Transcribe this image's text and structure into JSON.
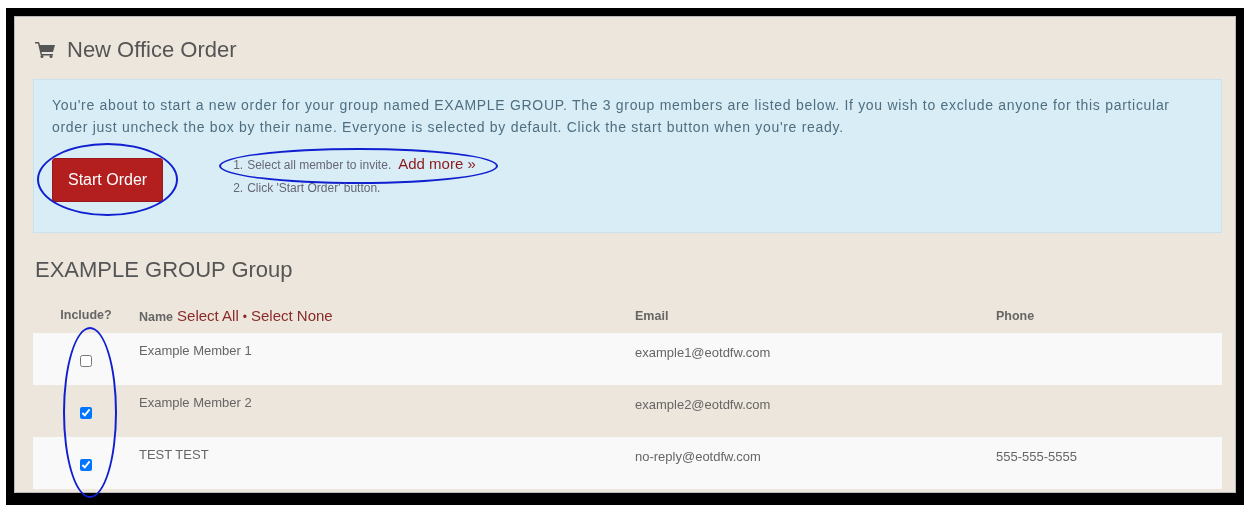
{
  "title": "New Office Order",
  "alert": {
    "text": "You're about to start a new order for your group named EXAMPLE GROUP. The 3 group members are listed below. If you wish to exclude anyone for this particular order just uncheck the box by their name. Everyone is selected by default. Click the start button when you're ready.",
    "button": {
      "label": "Start Order",
      "circled": true
    },
    "steps": [
      {
        "number": "1.",
        "text": "Select all member to invite.",
        "link": "Add more »",
        "circled": true
      },
      {
        "number": "2.",
        "text": "Click 'Start Order' button.",
        "circled": false
      }
    ]
  },
  "group_title": "EXAMPLE GROUP Group",
  "table": {
    "include_header": "Include?",
    "include_circled": true,
    "name_header": "Name",
    "select_all": "Select All",
    "separator": "•",
    "select_none": "Select None",
    "email_header": "Email",
    "phone_header": "Phone",
    "rows": [
      {
        "included": false,
        "name": "Example Member 1",
        "email": "example1@eotdfw.com"
      },
      {
        "included": true,
        "name": "Example Member 2",
        "email": "example2@eotdfw.com"
      },
      {
        "included": true,
        "name": "TEST TEST",
        "email": "no-reply@eotdfw.com",
        "phone": "555-555-5555"
      }
    ]
  }
}
